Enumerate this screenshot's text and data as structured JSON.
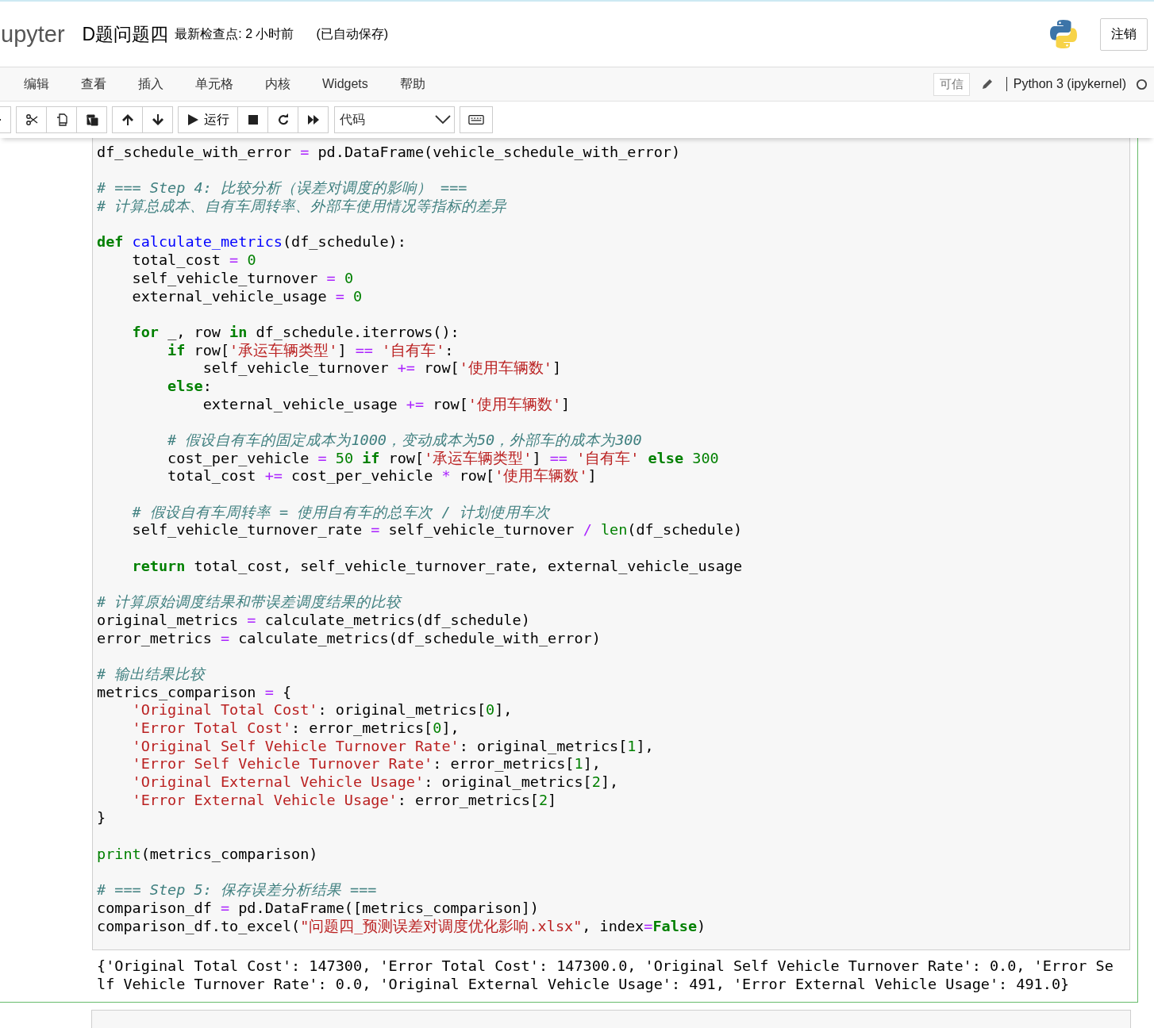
{
  "header": {
    "logo": "upyter",
    "notebook_title": "D题问题四",
    "checkpoint": "最新检查点: 2 小时前",
    "autosave": "(已自动保存)",
    "logout": "注销"
  },
  "menu": [
    "编辑",
    "查看",
    "插入",
    "单元格",
    "内核",
    "Widgets",
    "帮助"
  ],
  "kernel": {
    "trusted": "可信",
    "name": "Python 3 (ipykernel)"
  },
  "toolbar": {
    "run": "运行",
    "cell_type": "代码"
  },
  "code": [
    {
      "kind": "code",
      "segments": [
        {
          "text": "df_schedule_with_error ",
          "kind": "plain"
        },
        {
          "text": "= ",
          "kind": "operator"
        },
        {
          "text": "pd.DataFrame(vehicle_schedule_with_error)",
          "kind": "plain"
        }
      ]
    },
    {
      "kind": "blank"
    },
    {
      "kind": "code",
      "segments": [
        {
          "text": "# === Step 4: 比较分析（误差对调度的影响） ===",
          "kind": "comment"
        }
      ]
    },
    {
      "kind": "code",
      "segments": [
        {
          "text": "# 计算总成本、自有车周转率、外部车使用情况等指标的差异",
          "kind": "comment"
        }
      ]
    },
    {
      "kind": "blank"
    },
    {
      "kind": "code",
      "segments": [
        {
          "text": "def ",
          "kind": "keyword"
        },
        {
          "text": "calculate_metrics",
          "kind": "funcname"
        },
        {
          "text": "(df_schedule):",
          "kind": "plain"
        }
      ]
    },
    {
      "kind": "code",
      "segments": [
        {
          "text": "    total_cost ",
          "kind": "plain"
        },
        {
          "text": "= ",
          "kind": "operator"
        },
        {
          "text": "0",
          "kind": "number"
        }
      ]
    },
    {
      "kind": "code",
      "segments": [
        {
          "text": "    self_vehicle_turnover ",
          "kind": "plain"
        },
        {
          "text": "= ",
          "kind": "operator"
        },
        {
          "text": "0",
          "kind": "number"
        }
      ]
    },
    {
      "kind": "code",
      "segments": [
        {
          "text": "    external_vehicle_usage ",
          "kind": "plain"
        },
        {
          "text": "= ",
          "kind": "operator"
        },
        {
          "text": "0",
          "kind": "number"
        }
      ]
    },
    {
      "kind": "blank"
    },
    {
      "kind": "code",
      "segments": [
        {
          "text": "    for",
          "kind": "keyword"
        },
        {
          "text": " _, row ",
          "kind": "plain"
        },
        {
          "text": "in",
          "kind": "keyword"
        },
        {
          "text": " df_schedule.iterrows():",
          "kind": "plain"
        }
      ]
    },
    {
      "kind": "code",
      "segments": [
        {
          "text": "        if",
          "kind": "keyword"
        },
        {
          "text": " row[",
          "kind": "plain"
        },
        {
          "text": "'承运车辆类型'",
          "kind": "string"
        },
        {
          "text": "] ",
          "kind": "plain"
        },
        {
          "text": "== ",
          "kind": "operator"
        },
        {
          "text": "'自有车'",
          "kind": "string"
        },
        {
          "text": ":",
          "kind": "plain"
        }
      ]
    },
    {
      "kind": "code",
      "segments": [
        {
          "text": "            self_vehicle_turnover ",
          "kind": "plain"
        },
        {
          "text": "+=",
          "kind": "operator"
        },
        {
          "text": " row[",
          "kind": "plain"
        },
        {
          "text": "'使用车辆数'",
          "kind": "string"
        },
        {
          "text": "]",
          "kind": "plain"
        }
      ]
    },
    {
      "kind": "code",
      "segments": [
        {
          "text": "        else",
          "kind": "keyword"
        },
        {
          "text": ":",
          "kind": "plain"
        }
      ]
    },
    {
      "kind": "code",
      "segments": [
        {
          "text": "            external_vehicle_usage ",
          "kind": "plain"
        },
        {
          "text": "+=",
          "kind": "operator"
        },
        {
          "text": " row[",
          "kind": "plain"
        },
        {
          "text": "'使用车辆数'",
          "kind": "string"
        },
        {
          "text": "]",
          "kind": "plain"
        }
      ]
    },
    {
      "kind": "blank"
    },
    {
      "kind": "code",
      "segments": [
        {
          "text": "        # 假设自有车的固定成本为1000，变动成本为50，外部车的成本为300",
          "kind": "comment"
        }
      ]
    },
    {
      "kind": "code",
      "segments": [
        {
          "text": "        cost_per_vehicle ",
          "kind": "plain"
        },
        {
          "text": "= ",
          "kind": "operator"
        },
        {
          "text": "50 ",
          "kind": "number"
        },
        {
          "text": "if",
          "kind": "keyword"
        },
        {
          "text": " row[",
          "kind": "plain"
        },
        {
          "text": "'承运车辆类型'",
          "kind": "string"
        },
        {
          "text": "] ",
          "kind": "plain"
        },
        {
          "text": "== ",
          "kind": "operator"
        },
        {
          "text": "'自有车' ",
          "kind": "string"
        },
        {
          "text": "else ",
          "kind": "keyword"
        },
        {
          "text": "300",
          "kind": "number"
        }
      ]
    },
    {
      "kind": "code",
      "segments": [
        {
          "text": "        total_cost ",
          "kind": "plain"
        },
        {
          "text": "+=",
          "kind": "operator"
        },
        {
          "text": " cost_per_vehicle ",
          "kind": "plain"
        },
        {
          "text": "*",
          "kind": "operator"
        },
        {
          "text": " row[",
          "kind": "plain"
        },
        {
          "text": "'使用车辆数'",
          "kind": "string"
        },
        {
          "text": "]",
          "kind": "plain"
        }
      ]
    },
    {
      "kind": "blank"
    },
    {
      "kind": "code",
      "segments": [
        {
          "text": "    # 假设自有车周转率 = 使用自有车的总车次 / 计划使用车次",
          "kind": "comment"
        }
      ]
    },
    {
      "kind": "code",
      "segments": [
        {
          "text": "    self_vehicle_turnover_rate ",
          "kind": "plain"
        },
        {
          "text": "=",
          "kind": "operator"
        },
        {
          "text": " self_vehicle_turnover ",
          "kind": "plain"
        },
        {
          "text": "/ ",
          "kind": "operator"
        },
        {
          "text": "len",
          "kind": "builtin"
        },
        {
          "text": "(df_schedule)",
          "kind": "plain"
        }
      ]
    },
    {
      "kind": "blank"
    },
    {
      "kind": "code",
      "segments": [
        {
          "text": "    return",
          "kind": "keyword"
        },
        {
          "text": " total_cost, self_vehicle_turnover_rate, external_vehicle_usage",
          "kind": "plain"
        }
      ]
    },
    {
      "kind": "blank"
    },
    {
      "kind": "code",
      "segments": [
        {
          "text": "# 计算原始调度结果和带误差调度结果的比较",
          "kind": "comment"
        }
      ]
    },
    {
      "kind": "code",
      "segments": [
        {
          "text": "original_metrics ",
          "kind": "plain"
        },
        {
          "text": "=",
          "kind": "operator"
        },
        {
          "text": " calculate_metrics(df_schedule)",
          "kind": "plain"
        }
      ]
    },
    {
      "kind": "code",
      "segments": [
        {
          "text": "error_metrics ",
          "kind": "plain"
        },
        {
          "text": "=",
          "kind": "operator"
        },
        {
          "text": " calculate_metrics(df_schedule_with_error)",
          "kind": "plain"
        }
      ]
    },
    {
      "kind": "blank"
    },
    {
      "kind": "code",
      "segments": [
        {
          "text": "# 输出结果比较",
          "kind": "comment"
        }
      ]
    },
    {
      "kind": "code",
      "segments": [
        {
          "text": "metrics_comparison ",
          "kind": "plain"
        },
        {
          "text": "=",
          "kind": "operator"
        },
        {
          "text": " {",
          "kind": "plain"
        }
      ]
    },
    {
      "kind": "code",
      "segments": [
        {
          "text": "    'Original Total Cost'",
          "kind": "string"
        },
        {
          "text": ": original_metrics[",
          "kind": "plain"
        },
        {
          "text": "0",
          "kind": "number"
        },
        {
          "text": "],",
          "kind": "plain"
        }
      ]
    },
    {
      "kind": "code",
      "segments": [
        {
          "text": "    'Error Total Cost'",
          "kind": "string"
        },
        {
          "text": ": error_metrics[",
          "kind": "plain"
        },
        {
          "text": "0",
          "kind": "number"
        },
        {
          "text": "],",
          "kind": "plain"
        }
      ]
    },
    {
      "kind": "code",
      "segments": [
        {
          "text": "    'Original Self Vehicle Turnover Rate'",
          "kind": "string"
        },
        {
          "text": ": original_metrics[",
          "kind": "plain"
        },
        {
          "text": "1",
          "kind": "number"
        },
        {
          "text": "],",
          "kind": "plain"
        }
      ]
    },
    {
      "kind": "code",
      "segments": [
        {
          "text": "    'Error Self Vehicle Turnover Rate'",
          "kind": "string"
        },
        {
          "text": ": error_metrics[",
          "kind": "plain"
        },
        {
          "text": "1",
          "kind": "number"
        },
        {
          "text": "],",
          "kind": "plain"
        }
      ]
    },
    {
      "kind": "code",
      "segments": [
        {
          "text": "    'Original External Vehicle Usage'",
          "kind": "string"
        },
        {
          "text": ": original_metrics[",
          "kind": "plain"
        },
        {
          "text": "2",
          "kind": "number"
        },
        {
          "text": "],",
          "kind": "plain"
        }
      ]
    },
    {
      "kind": "code",
      "segments": [
        {
          "text": "    'Error External Vehicle Usage'",
          "kind": "string"
        },
        {
          "text": ": error_metrics[",
          "kind": "plain"
        },
        {
          "text": "2",
          "kind": "number"
        },
        {
          "text": "]",
          "kind": "plain"
        }
      ]
    },
    {
      "kind": "code",
      "segments": [
        {
          "text": "}",
          "kind": "plain"
        }
      ]
    },
    {
      "kind": "blank"
    },
    {
      "kind": "code",
      "segments": [
        {
          "text": "print",
          "kind": "builtin"
        },
        {
          "text": "(metrics_comparison)",
          "kind": "plain"
        }
      ]
    },
    {
      "kind": "blank"
    },
    {
      "kind": "code",
      "segments": [
        {
          "text": "# === Step 5: 保存误差分析结果 ===",
          "kind": "comment"
        }
      ]
    },
    {
      "kind": "code",
      "segments": [
        {
          "text": "comparison_df ",
          "kind": "plain"
        },
        {
          "text": "=",
          "kind": "operator"
        },
        {
          "text": " pd.DataFrame([metrics_comparison])",
          "kind": "plain"
        }
      ]
    },
    {
      "kind": "code",
      "segments": [
        {
          "text": "comparison_df.to_excel(",
          "kind": "plain"
        },
        {
          "text": "\"问题四_预测误差对调度优化影响.xlsx\"",
          "kind": "string"
        },
        {
          "text": ", index",
          "kind": "plain"
        },
        {
          "text": "=",
          "kind": "operator"
        },
        {
          "text": "False",
          "kind": "keyword"
        },
        {
          "text": ")",
          "kind": "plain"
        }
      ]
    }
  ],
  "output": [
    "{'Original Total Cost': 147300, 'Error Total Cost': 147300.0, 'Original Self Vehicle Turnover Rate': 0.0, 'Error Se",
    "lf Vehicle Turnover Rate': 0.0, 'Original External Vehicle Usage': 491, 'Error External Vehicle Usage': 491.0}"
  ]
}
